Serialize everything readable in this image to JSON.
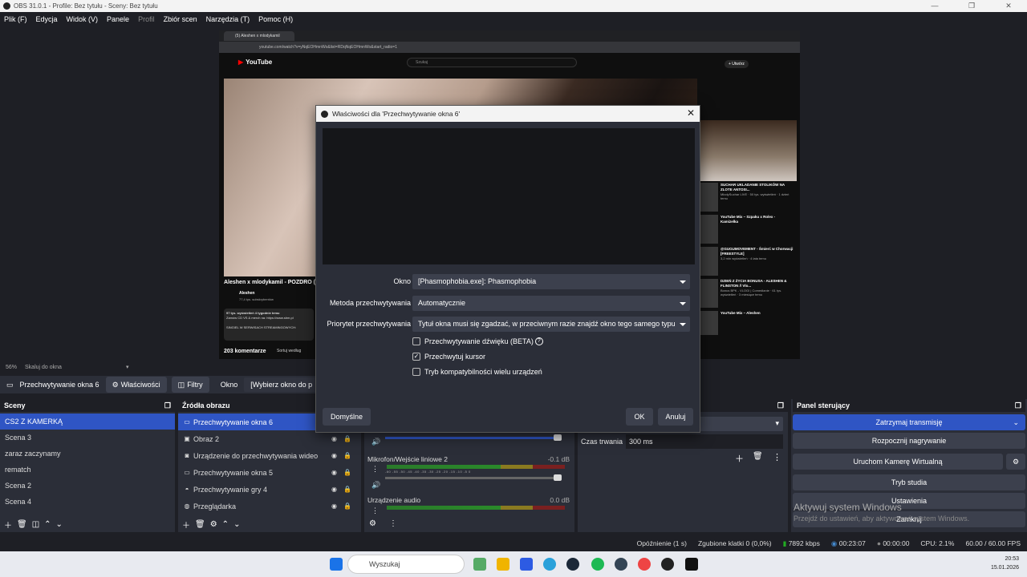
{
  "window": {
    "title": "OBS 31.0.1 - Profile: Bez tytułu - Sceny: Bez tytułu"
  },
  "menu": [
    "Plik (F)",
    "Edycja",
    "Widok (V)",
    "Panele",
    "Profil",
    "Zbiór scen",
    "Narzędzia (T)",
    "Pomoc (H)"
  ],
  "preview": {
    "tab": "(5) Aleshen x mlodykamil",
    "url": "youtube.com/watch?v=yNqEOHmnWo&list=RDqNqEOHmnWo&start_radio=1",
    "search_placeholder": "Szukaj",
    "create_label": "+ Utwórz",
    "logo": "YouTube",
    "video_title": "Aleshen x mlodykamil - POZDRO (",
    "channel": "Aleshen",
    "channel_subs": "77,4 tys. subskrybentów",
    "desc_line1": "97 tys. wyświetleń 4 tygodnie temu",
    "desc_line2": "Zamów CD VS & merch na: https://www.sbm.pl",
    "desc_line3": "SINGIEL W SERWISACH STREAMINGOWYCH:",
    "comments": "203 komentarze",
    "sort": "Sortuj według",
    "recs": [
      {
        "title": "SUCHAR UKLADANIE STOLIKÓW NA ZLOTE ANTOSI...",
        "sub": "MłodySuchar LIVE · 50 tys. wyświetleń · 1 dzień temu"
      },
      {
        "title": "YouTube Mix – Szpaku x Rolex - Kamizelka",
        "sub": ""
      },
      {
        "title": "@GUGUMOVEMENT - Śmierć w Chorwacji [FREESTYLE]",
        "sub": "3,2 mln wyświetleń · 4 lata temu"
      },
      {
        "title": "DZIEŃ Z ŻYCIA BONUSA - ALESHEN & FLINSTON // Vlo...",
        "sub": "Bonus BPK - VLOGI | Comedianie · 61 tys. wyświetleń · 3 miesiące temu"
      },
      {
        "title": "YouTube Mix – Aleshen",
        "sub": ""
      }
    ]
  },
  "scale": {
    "zoom": "56%",
    "mode": "Skaluj do okna"
  },
  "source_toolbar": {
    "source": "Przechwytywanie okna 6",
    "properties": "Właściwości",
    "filters": "Filtry",
    "window_label": "Okno",
    "window_value": "[Wybierz okno do p"
  },
  "scenes": {
    "title": "Sceny",
    "items": [
      "CS2 Z KAMERKĄ",
      "Scena 3",
      "zaraz zaczynamy",
      "rematch",
      "Scena 2",
      "Scena 4"
    ]
  },
  "sources": {
    "title": "Źródła obrazu",
    "items": [
      {
        "label": "Przechwytywanie okna 6",
        "icon": "window-icon"
      },
      {
        "label": "Obraz 2",
        "icon": "image-icon"
      },
      {
        "label": "Urządzenie do przechwytywania wideo",
        "icon": "camera-icon"
      },
      {
        "label": "Przechwytywanie okna 5",
        "icon": "window-icon"
      },
      {
        "label": "Przechwytywanie gry 4",
        "icon": "gamepad-icon"
      },
      {
        "label": "Przeglądarka",
        "icon": "globe-icon"
      }
    ]
  },
  "mixer": {
    "channels": [
      {
        "name": "Mikrofon/Wejście liniowe 2",
        "db": "-0.1 dB"
      },
      {
        "name": "Urządzenie audio",
        "db": "0.0 dB"
      }
    ],
    "scale": "-60 -55 -50 -45 -40 -35 -30 -25 -20 -15 -10 -5 0"
  },
  "transitions": {
    "duration_label": "Czas trwania",
    "duration_value": "300 ms"
  },
  "controls": {
    "title": "Panel sterujący",
    "stop_stream": "Zatrzymaj transmisję",
    "start_record": "Rozpocznij nagrywanie",
    "virtual_cam": "Uruchom Kamerę Wirtualną",
    "studio": "Tryb studia",
    "settings": "Ustawienia",
    "close": "Zamknij"
  },
  "activate": {
    "title": "Aktywuj system Windows",
    "sub": "Przejdź do ustawień, aby aktywować system Windows."
  },
  "status": {
    "delay": "Opóźnienie (1 s)",
    "dropped": "Zgubione klatki 0 (0,0%)",
    "bitrate": "7892 kbps",
    "live_time": "00:23:07",
    "rec_time": "00:00:00",
    "cpu": "CPU: 2.1%",
    "fps": "60.00 / 60.00 FPS"
  },
  "taskbar": {
    "search": "Wyszukaj",
    "time": "20:53",
    "date": "15.01.2026"
  },
  "dialog": {
    "title": "Właściwości dla 'Przechwytywanie okna 6'",
    "window_label": "Okno",
    "window_value": "[Phasmophobia.exe]: Phasmophobia",
    "method_label": "Metoda przechwytywania",
    "method_value": "Automatycznie",
    "priority_label": "Priorytet przechwytywania",
    "priority_value": "Tytuł okna musi się zgadzać, w przeciwnym razie znajdź okno tego samego typu",
    "audio_label": "Przechwytywanie dźwięku (BETA)",
    "cursor_label": "Przechwytuj kursor",
    "compat_label": "Tryb kompatybilności wielu urządzeń",
    "defaults": "Domyślne",
    "ok": "OK",
    "cancel": "Anuluj"
  }
}
